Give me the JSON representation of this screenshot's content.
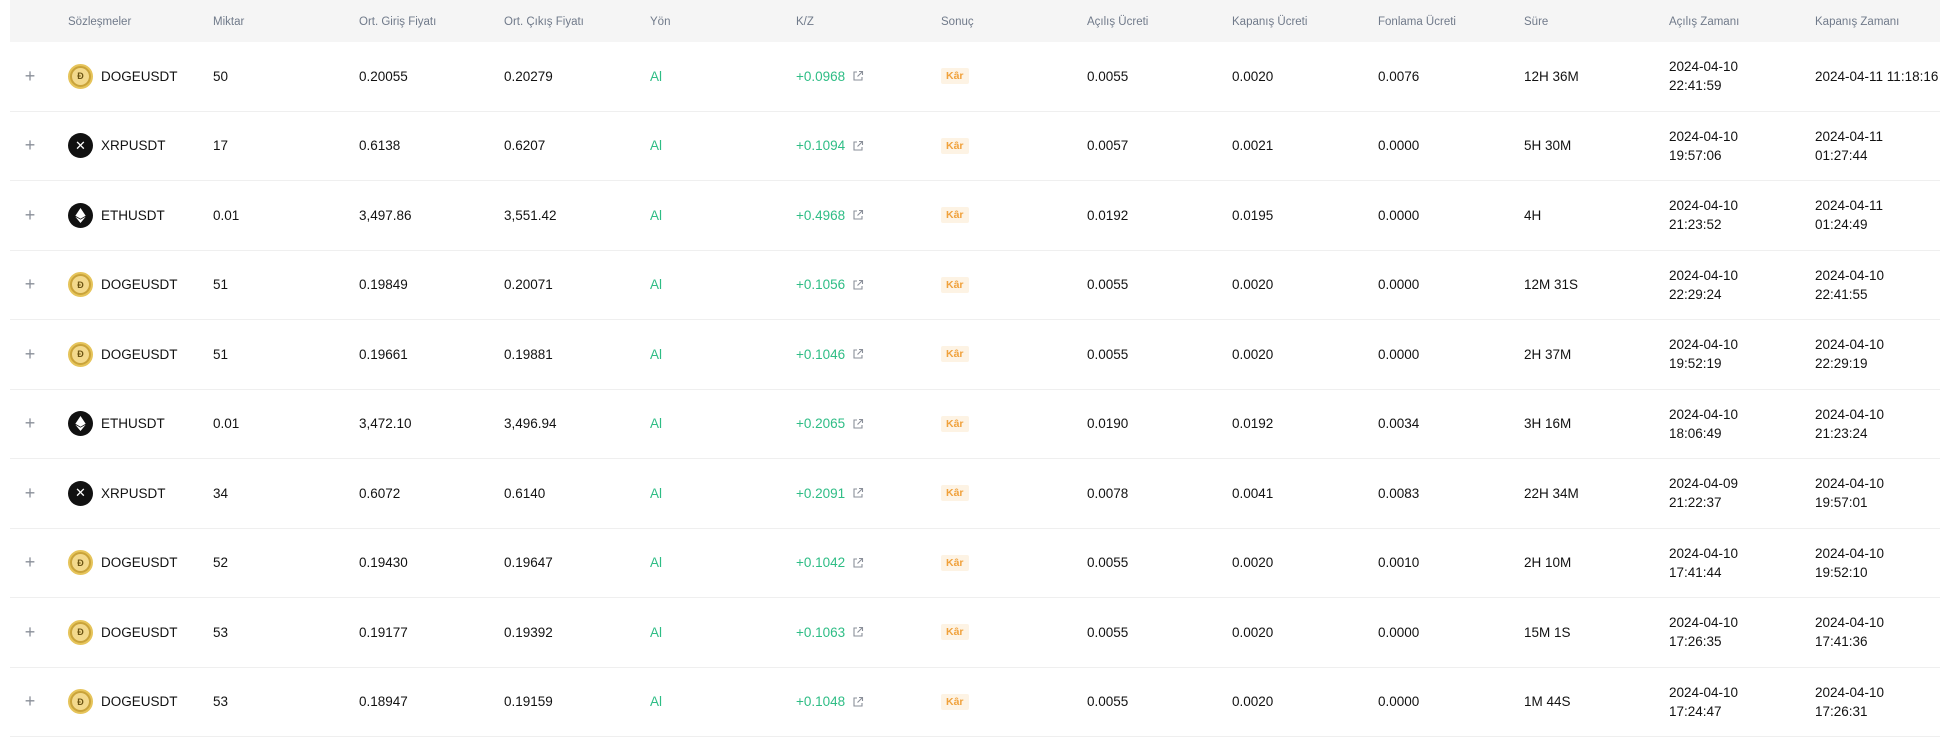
{
  "columns": {
    "contract": "Sözleşmeler",
    "qty": "Miktar",
    "entry": "Ort. Giriş Fiyatı",
    "exit": "Ort. Çıkış Fiyatı",
    "side": "Yön",
    "pnl": "K/Z",
    "result": "Sonuç",
    "open_fee": "Açılış Ücreti",
    "close_fee": "Kapanış Ücreti",
    "funding_fee": "Fonlama Ücreti",
    "duration": "Süre",
    "open_time": "Açılış Zamanı",
    "close_time": "Kapanış Zamanı"
  },
  "colors": {
    "positive": "#2ebd85",
    "badge_text": "#f0a13b",
    "badge_bg": "#fdf3e4",
    "header_bg": "#f5f5f5"
  },
  "rows": [
    {
      "icon": "doge-icon",
      "contract": "DOGEUSDT",
      "qty": "50",
      "entry": "0.20055",
      "exit": "0.20279",
      "side": "Al",
      "pnl": "+0.0968",
      "result": "Kâr",
      "open_fee": "0.0055",
      "close_fee": "0.0020",
      "funding_fee": "0.0076",
      "duration": "12H 36M",
      "open_date": "2024-04-10",
      "open_clock": "22:41:59",
      "close_date": "2024-04-11 11:18:16",
      "close_clock": ""
    },
    {
      "icon": "xrp-icon",
      "contract": "XRPUSDT",
      "qty": "17",
      "entry": "0.6138",
      "exit": "0.6207",
      "side": "Al",
      "pnl": "+0.1094",
      "result": "Kâr",
      "open_fee": "0.0057",
      "close_fee": "0.0021",
      "funding_fee": "0.0000",
      "duration": "5H 30M",
      "open_date": "2024-04-10",
      "open_clock": "19:57:06",
      "close_date": "2024-04-11",
      "close_clock": "01:27:44"
    },
    {
      "icon": "eth-icon",
      "contract": "ETHUSDT",
      "qty": "0.01",
      "entry": "3,497.86",
      "exit": "3,551.42",
      "side": "Al",
      "pnl": "+0.4968",
      "result": "Kâr",
      "open_fee": "0.0192",
      "close_fee": "0.0195",
      "funding_fee": "0.0000",
      "duration": "4H",
      "open_date": "2024-04-10",
      "open_clock": "21:23:52",
      "close_date": "2024-04-11",
      "close_clock": "01:24:49"
    },
    {
      "icon": "doge-icon",
      "contract": "DOGEUSDT",
      "qty": "51",
      "entry": "0.19849",
      "exit": "0.20071",
      "side": "Al",
      "pnl": "+0.1056",
      "result": "Kâr",
      "open_fee": "0.0055",
      "close_fee": "0.0020",
      "funding_fee": "0.0000",
      "duration": "12M 31S",
      "open_date": "2024-04-10",
      "open_clock": "22:29:24",
      "close_date": "2024-04-10",
      "close_clock": "22:41:55"
    },
    {
      "icon": "doge-icon",
      "contract": "DOGEUSDT",
      "qty": "51",
      "entry": "0.19661",
      "exit": "0.19881",
      "side": "Al",
      "pnl": "+0.1046",
      "result": "Kâr",
      "open_fee": "0.0055",
      "close_fee": "0.0020",
      "funding_fee": "0.0000",
      "duration": "2H 37M",
      "open_date": "2024-04-10",
      "open_clock": "19:52:19",
      "close_date": "2024-04-10",
      "close_clock": "22:29:19"
    },
    {
      "icon": "eth-icon",
      "contract": "ETHUSDT",
      "qty": "0.01",
      "entry": "3,472.10",
      "exit": "3,496.94",
      "side": "Al",
      "pnl": "+0.2065",
      "result": "Kâr",
      "open_fee": "0.0190",
      "close_fee": "0.0192",
      "funding_fee": "0.0034",
      "duration": "3H 16M",
      "open_date": "2024-04-10",
      "open_clock": "18:06:49",
      "close_date": "2024-04-10",
      "close_clock": "21:23:24"
    },
    {
      "icon": "xrp-icon",
      "contract": "XRPUSDT",
      "qty": "34",
      "entry": "0.6072",
      "exit": "0.6140",
      "side": "Al",
      "pnl": "+0.2091",
      "result": "Kâr",
      "open_fee": "0.0078",
      "close_fee": "0.0041",
      "funding_fee": "0.0083",
      "duration": "22H 34M",
      "open_date": "2024-04-09",
      "open_clock": "21:22:37",
      "close_date": "2024-04-10",
      "close_clock": "19:57:01"
    },
    {
      "icon": "doge-icon",
      "contract": "DOGEUSDT",
      "qty": "52",
      "entry": "0.19430",
      "exit": "0.19647",
      "side": "Al",
      "pnl": "+0.1042",
      "result": "Kâr",
      "open_fee": "0.0055",
      "close_fee": "0.0020",
      "funding_fee": "0.0010",
      "duration": "2H 10M",
      "open_date": "2024-04-10",
      "open_clock": "17:41:44",
      "close_date": "2024-04-10",
      "close_clock": "19:52:10"
    },
    {
      "icon": "doge-icon",
      "contract": "DOGEUSDT",
      "qty": "53",
      "entry": "0.19177",
      "exit": "0.19392",
      "side": "Al",
      "pnl": "+0.1063",
      "result": "Kâr",
      "open_fee": "0.0055",
      "close_fee": "0.0020",
      "funding_fee": "0.0000",
      "duration": "15M 1S",
      "open_date": "2024-04-10",
      "open_clock": "17:26:35",
      "close_date": "2024-04-10",
      "close_clock": "17:41:36"
    },
    {
      "icon": "doge-icon",
      "contract": "DOGEUSDT",
      "qty": "53",
      "entry": "0.18947",
      "exit": "0.19159",
      "side": "Al",
      "pnl": "+0.1048",
      "result": "Kâr",
      "open_fee": "0.0055",
      "close_fee": "0.0020",
      "funding_fee": "0.0000",
      "duration": "1M 44S",
      "open_date": "2024-04-10",
      "open_clock": "17:24:47",
      "close_date": "2024-04-10",
      "close_clock": "17:26:31"
    }
  ]
}
